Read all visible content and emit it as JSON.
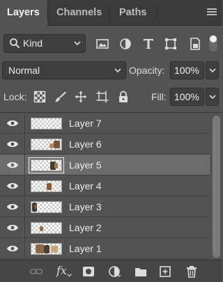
{
  "tabs": [
    {
      "label": "Layers",
      "active": true
    },
    {
      "label": "Channels",
      "active": false
    },
    {
      "label": "Paths",
      "active": false
    }
  ],
  "filter": {
    "kind_label": "Kind",
    "icons": [
      "pixel-layer-filter-icon",
      "adjustment-layer-filter-icon",
      "type-layer-filter-icon",
      "shape-layer-filter-icon",
      "smart-object-filter-icon"
    ]
  },
  "blend": {
    "mode": "Normal",
    "opacity_label": "Opacity:",
    "opacity_value": "100%"
  },
  "lock": {
    "label": "Lock:",
    "icons": [
      "lock-transparent-pixels-icon",
      "lock-image-pixels-icon",
      "lock-position-icon",
      "lock-artboard-icon",
      "lock-all-icon"
    ],
    "fill_label": "Fill:",
    "fill_value": "100%"
  },
  "layers": [
    {
      "name": "Layer 7",
      "visible": true,
      "selected": false
    },
    {
      "name": "Layer 6",
      "visible": true,
      "selected": false
    },
    {
      "name": "Layer 5",
      "visible": true,
      "selected": true
    },
    {
      "name": "Layer 4",
      "visible": true,
      "selected": false
    },
    {
      "name": "Layer 3",
      "visible": true,
      "selected": false
    },
    {
      "name": "Layer 2",
      "visible": true,
      "selected": false
    },
    {
      "name": "Layer 1",
      "visible": true,
      "selected": false
    }
  ],
  "bottom_bar": {
    "fx_label": "fx",
    "icons": [
      "link-layers-icon",
      "layer-style-icon",
      "add-mask-icon",
      "adjustment-layer-icon",
      "new-group-icon",
      "new-layer-icon",
      "delete-layer-icon"
    ]
  },
  "colors": {
    "panel_bg": "#535353",
    "tabbar_bg": "#3b3b3b",
    "selected_row": "#6c6c6c",
    "field_bg": "#3f3f3f"
  }
}
